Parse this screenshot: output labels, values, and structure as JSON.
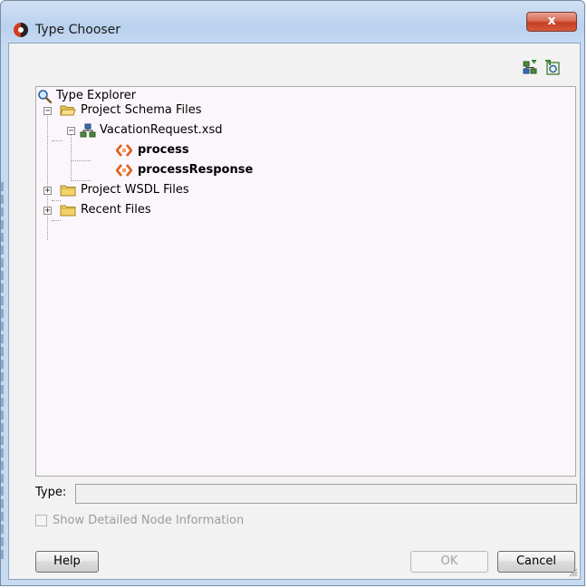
{
  "window": {
    "title": "Type Chooser",
    "close_label": "x"
  },
  "toolbar": {
    "icons": [
      "schema-add-icon",
      "import-wsdl-icon"
    ]
  },
  "tree": {
    "root_label": "Type Explorer",
    "nodes": [
      {
        "label": "Project Schema Files",
        "expanded": true
      },
      {
        "label": "VacationRequest.xsd",
        "expanded": true
      },
      {
        "label": "process"
      },
      {
        "label": "processResponse"
      },
      {
        "label": "Project WSDL Files",
        "expanded": false
      },
      {
        "label": "Recent Files",
        "expanded": false
      }
    ]
  },
  "form": {
    "type_label": "Type:",
    "type_value": "",
    "show_detailed_label": "Show Detailed Node Information",
    "show_detailed_checked": false
  },
  "buttons": {
    "help": "Help",
    "ok": "OK",
    "cancel": "Cancel"
  },
  "colors": {
    "titlebar": "#c6daf2",
    "close_button": "#c43d22",
    "tree_background": "#fbf6fb",
    "element_icon": "#e0601a"
  }
}
